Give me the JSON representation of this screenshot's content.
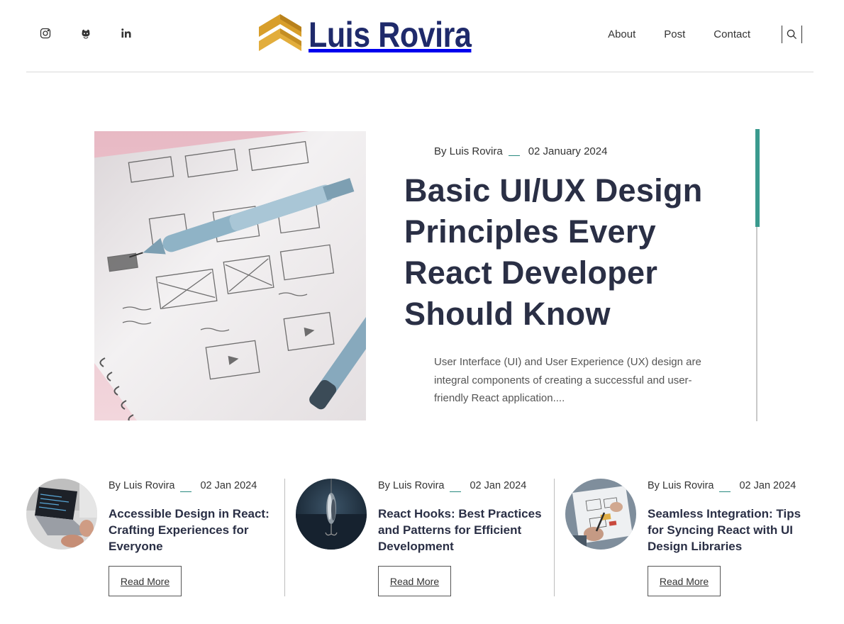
{
  "header": {
    "social": [
      {
        "name": "instagram-icon"
      },
      {
        "name": "github-icon"
      },
      {
        "name": "linkedin-icon"
      }
    ],
    "logo_text": "Luis Rovira",
    "nav": [
      "About",
      "Post",
      "Contact"
    ],
    "search_icon": "search-icon"
  },
  "featured": {
    "author": "By Luis Rovira",
    "date": "02 January 2024",
    "title": "Basic UI/UX Design Principles Every React Developer Should Know",
    "excerpt": "User Interface (UI) and User Experience (UX) design are integral components of creating a successful and user-friendly React application...."
  },
  "cards": [
    {
      "author": "By Luis Rovira",
      "date": "02 Jan 2024",
      "title": "Accessible Design in React: Crafting Experiences for Everyone",
      "button": "Read More"
    },
    {
      "author": "By Luis Rovira",
      "date": "02 Jan 2024",
      "title": "React Hooks: Best Practices and Patterns for Efficient Development",
      "button": "Read More"
    },
    {
      "author": "By Luis Rovira",
      "date": "02 Jan 2024",
      "title": "Seamless Integration: Tips for Syncing React with UI Design Libraries",
      "button": "Read More"
    }
  ],
  "colors": {
    "accent": "#3a9a8e",
    "title": "#2a2f45",
    "logo_blue": "#1f2a6b",
    "logo_gold": "#d89e2a"
  }
}
